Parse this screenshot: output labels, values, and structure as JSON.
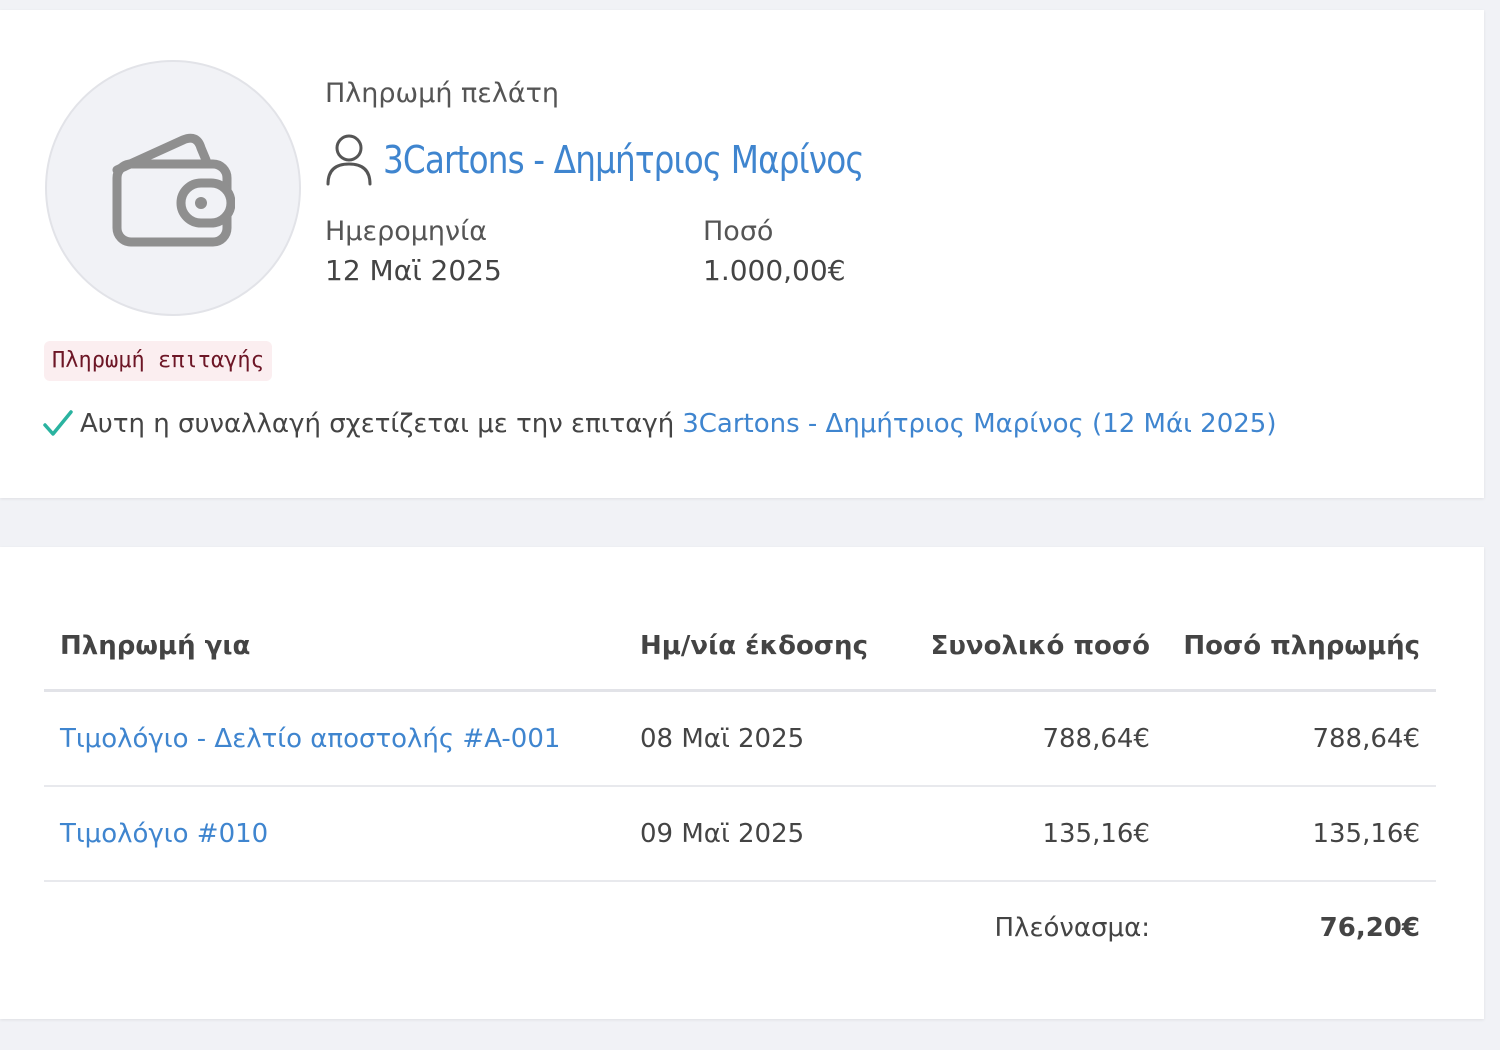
{
  "payment": {
    "type_label": "Πληρωμή πελάτη",
    "customer_name": "3Cartons - Δημήτριος Μαρίνος",
    "date_label": "Ημερομηνία",
    "date_value": "12 Μαϊ 2025",
    "amount_label": "Ποσό",
    "amount_value": "1.000,00€",
    "code_badge": "Πληρωμή επιταγής",
    "relation_text": "Αυτη η συναλλαγή σχετίζεται με την επιταγή",
    "relation_link": "3Cartons - Δημήτριος Μαρίνος (12 Μάι 2025)"
  },
  "icons": {
    "avatar": "wallet-icon",
    "customer": "user-icon",
    "relation": "check-icon"
  },
  "colors": {
    "link": "#3f85cf",
    "check": "#2ab3a0",
    "badge_bg": "#fbeef0",
    "badge_text": "#6d1626"
  },
  "table": {
    "headers": {
      "payment_for": "Πληρωμή για",
      "issue_date": "Ημ/νία έκδοσης",
      "total_amount": "Συνολικό ποσό",
      "payment_amount": "Ποσό πληρωμής"
    },
    "rows": [
      {
        "document": "Τιμολόγιο - Δελτίο αποστολής #A-001",
        "issue_date": "08 Μαϊ 2025",
        "total": "788,64€",
        "paid": "788,64€"
      },
      {
        "document": "Τιμολόγιο #010",
        "issue_date": "09 Μαϊ 2025",
        "total": "135,16€",
        "paid": "135,16€"
      }
    ],
    "surplus_label": "Πλεόνασμα:",
    "surplus_value": "76,20€"
  }
}
